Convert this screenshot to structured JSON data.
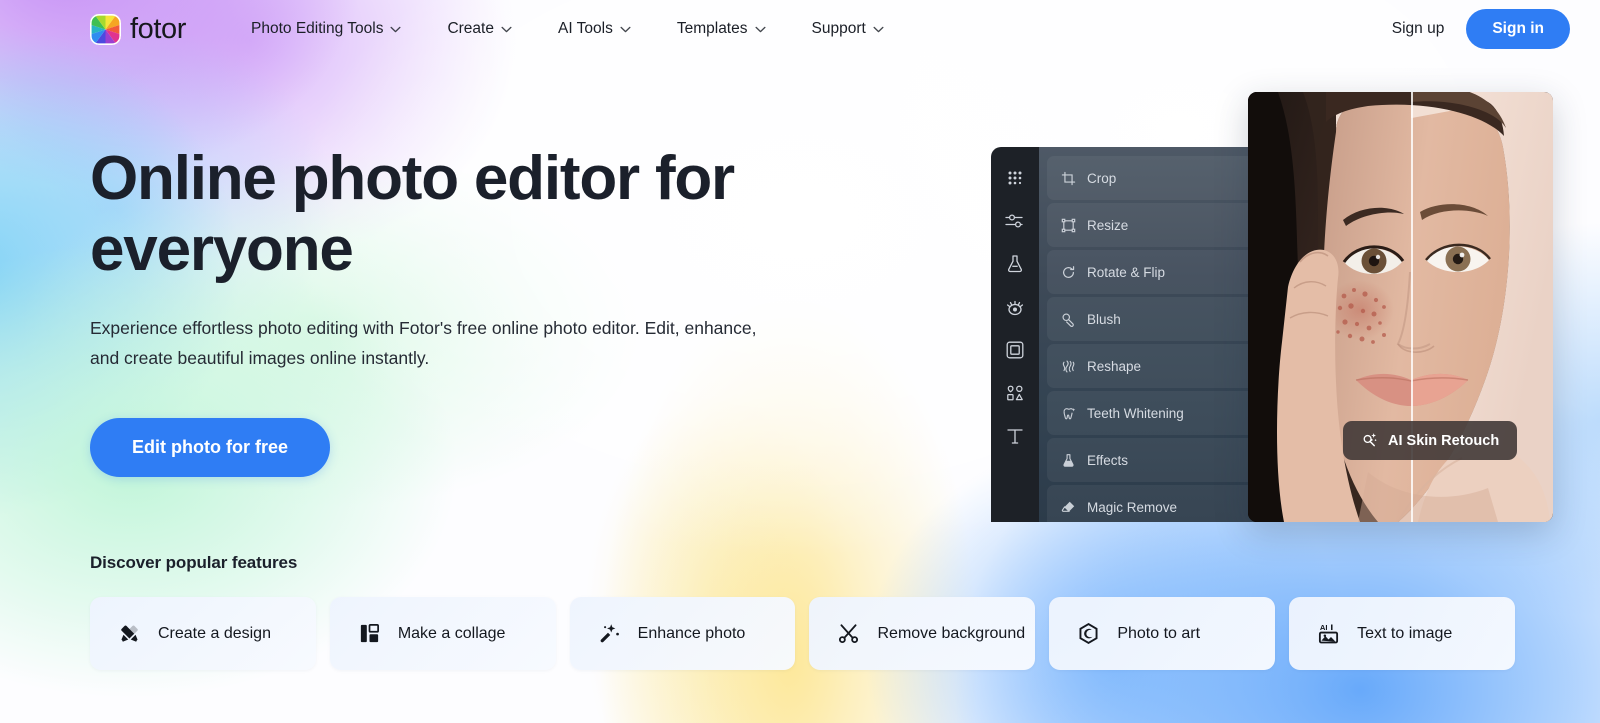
{
  "brand": {
    "name": "fotor",
    "logo_icon": "fotor-color-wheel-icon",
    "accent_color": "#2f7df4"
  },
  "header": {
    "nav": [
      {
        "label": "Photo Editing Tools",
        "has_dropdown": true
      },
      {
        "label": "Create",
        "has_dropdown": true
      },
      {
        "label": "AI Tools",
        "has_dropdown": true
      },
      {
        "label": "Templates",
        "has_dropdown": true
      },
      {
        "label": "Support",
        "has_dropdown": true
      }
    ],
    "signup_label": "Sign up",
    "signin_label": "Sign in"
  },
  "hero": {
    "heading": "Online photo editor for everyone",
    "subheading": "Experience effortless photo editing with Fotor's free online photo editor. Edit, enhance, and create beautiful images online instantly.",
    "cta_label": "Edit photo for free"
  },
  "editor": {
    "rail_icons": [
      "grid-dots-icon",
      "adjust-sliders-icon",
      "flask-effects-icon",
      "eye-retouch-icon",
      "frame-border-icon",
      "stickers-shapes-icon",
      "text-tool-icon"
    ],
    "tools": [
      {
        "label": "Crop",
        "icon": "crop-icon"
      },
      {
        "label": "Resize",
        "icon": "resize-icon"
      },
      {
        "label": "Rotate & Flip",
        "icon": "rotate-icon"
      },
      {
        "label": "Blush",
        "icon": "blush-icon"
      },
      {
        "label": "Reshape",
        "icon": "reshape-icon"
      },
      {
        "label": "Teeth Whitening",
        "icon": "tooth-icon"
      },
      {
        "label": "Effects",
        "icon": "effects-flask-icon"
      },
      {
        "label": "Magic Remove",
        "icon": "eraser-icon"
      }
    ],
    "tooltip": {
      "label": "AI Skin Retouch",
      "icon": "ai-sparkle-wand-icon"
    }
  },
  "discover": {
    "title": "Discover popular features",
    "cards": [
      {
        "label": "Create a design",
        "icon": "pencil-ruler-icon"
      },
      {
        "label": "Make a collage",
        "icon": "collage-grid-icon"
      },
      {
        "label": "Enhance photo",
        "icon": "magic-wand-icon"
      },
      {
        "label": "Remove background",
        "icon": "scissors-icon"
      },
      {
        "label": "Photo to art",
        "icon": "art-hexagon-icon"
      },
      {
        "label": "Text to image",
        "icon": "ai-image-icon"
      }
    ]
  }
}
